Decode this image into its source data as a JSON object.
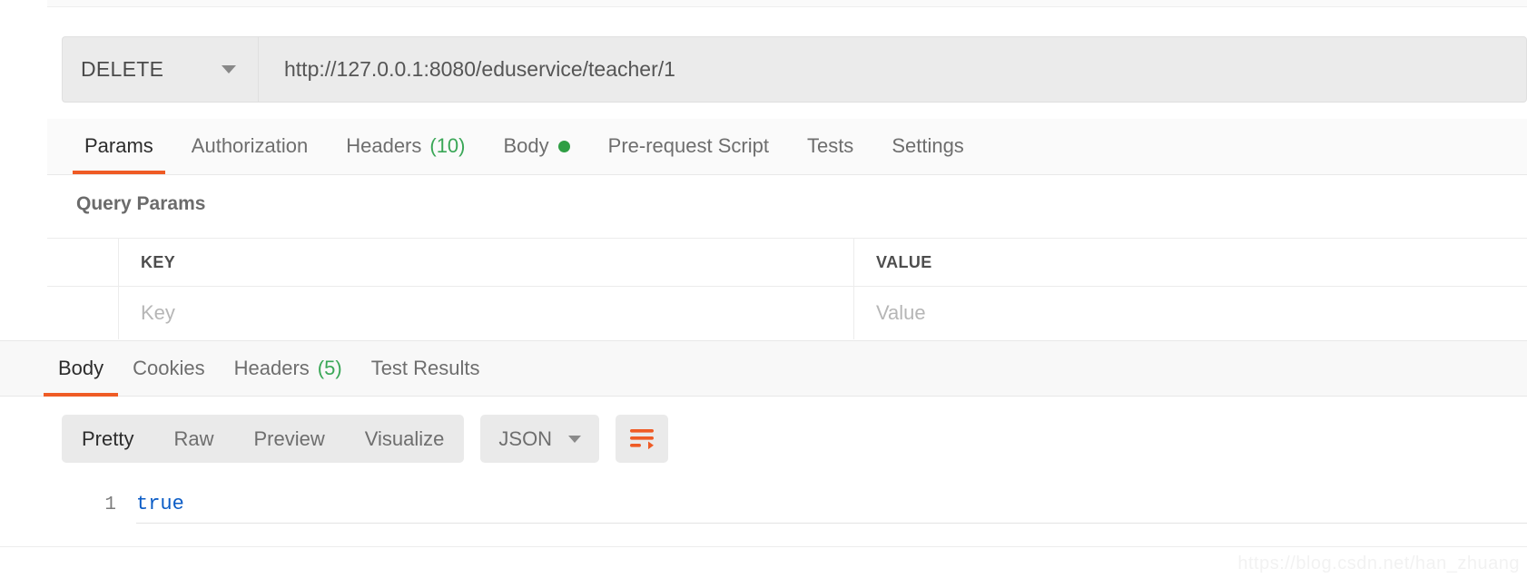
{
  "request": {
    "method": "DELETE",
    "method_caret_icon": "chevron-down-icon",
    "url": "http://127.0.0.1:8080/eduservice/teacher/1"
  },
  "request_tabs": [
    {
      "label": "Params",
      "active": true,
      "count": "",
      "dot": false
    },
    {
      "label": "Authorization",
      "active": false,
      "count": "",
      "dot": false
    },
    {
      "label": "Headers",
      "active": false,
      "count": "(10)",
      "dot": false
    },
    {
      "label": "Body",
      "active": false,
      "count": "",
      "dot": true
    },
    {
      "label": "Pre-request Script",
      "active": false,
      "count": "",
      "dot": false
    },
    {
      "label": "Tests",
      "active": false,
      "count": "",
      "dot": false
    },
    {
      "label": "Settings",
      "active": false,
      "count": "",
      "dot": false
    }
  ],
  "query_params": {
    "section_title": "Query Params",
    "columns": [
      "KEY",
      "VALUE"
    ],
    "rows": [
      {
        "key_placeholder": "Key",
        "value_placeholder": "Value"
      }
    ]
  },
  "response_tabs": [
    {
      "label": "Body",
      "active": true,
      "count": ""
    },
    {
      "label": "Cookies",
      "active": false,
      "count": ""
    },
    {
      "label": "Headers",
      "active": false,
      "count": "(5)"
    },
    {
      "label": "Test Results",
      "active": false,
      "count": ""
    }
  ],
  "body_toolbar": {
    "views": [
      {
        "label": "Pretty",
        "active": true
      },
      {
        "label": "Raw",
        "active": false
      },
      {
        "label": "Preview",
        "active": false
      },
      {
        "label": "Visualize",
        "active": false
      }
    ],
    "format": "JSON",
    "format_caret_icon": "chevron-down-icon",
    "wrap_icon": "word-wrap-icon"
  },
  "response_body": {
    "lines": [
      {
        "number": "1",
        "content": "true"
      }
    ]
  },
  "watermark": "https://blog.csdn.net/han_zhuang",
  "colors": {
    "accent": "#ef5b25",
    "green": "#2f9e44",
    "count_green": "#3aa757",
    "code_blue": "#0b5cc6",
    "chrome_gray": "#ebebeb"
  }
}
